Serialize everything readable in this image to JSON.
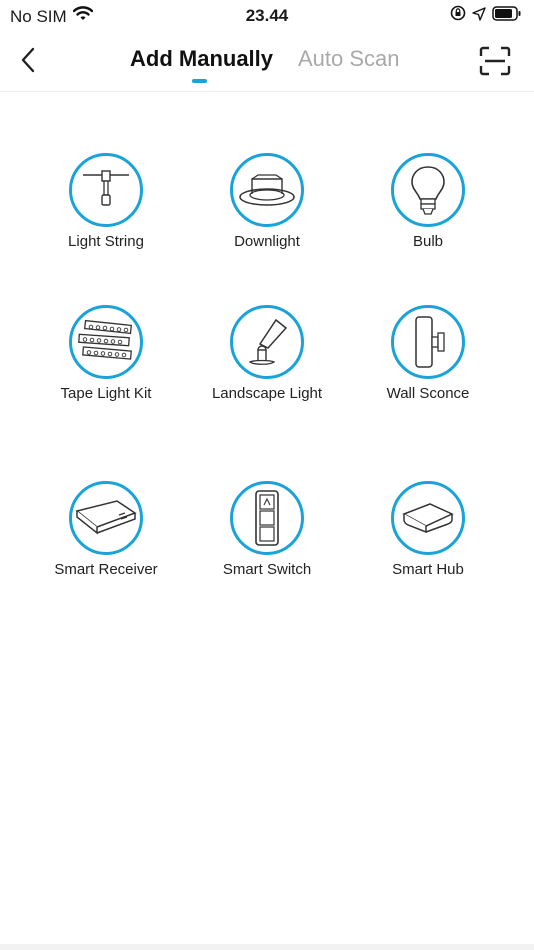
{
  "status_bar": {
    "carrier": "No SIM",
    "time": "23.44"
  },
  "nav": {
    "tabs": [
      {
        "label": "Add Manually",
        "active": true
      },
      {
        "label": "Auto Scan",
        "active": false
      }
    ],
    "accent_color": "#1aa3d9"
  },
  "devices": [
    {
      "label": "Light String",
      "icon": "light-string-icon"
    },
    {
      "label": "Downlight",
      "icon": "downlight-icon"
    },
    {
      "label": "Bulb",
      "icon": "bulb-icon"
    },
    {
      "label": "Tape Light Kit",
      "icon": "tape-light-icon"
    },
    {
      "label": "Landscape Light",
      "icon": "landscape-light-icon"
    },
    {
      "label": "Wall Sconce",
      "icon": "wall-sconce-icon"
    },
    {
      "label": "Smart Receiver",
      "icon": "smart-receiver-icon"
    },
    {
      "label": "Smart Switch",
      "icon": "smart-switch-icon"
    },
    {
      "label": "Smart Hub",
      "icon": "smart-hub-icon"
    }
  ]
}
